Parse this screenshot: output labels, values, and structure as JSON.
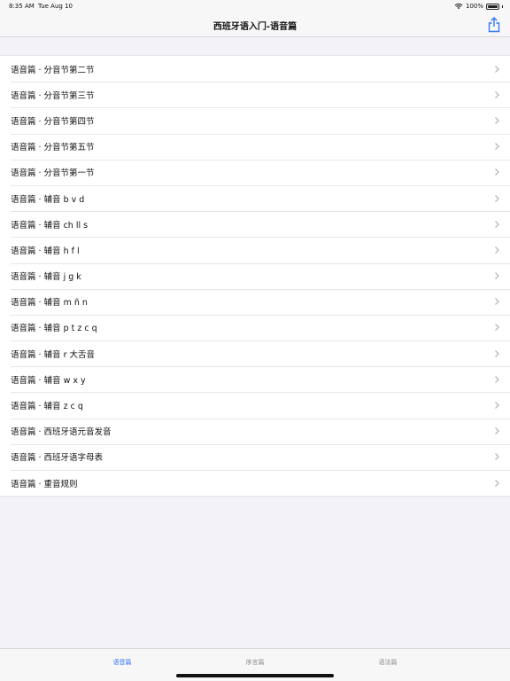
{
  "status_bar": {
    "time": "8:35 AM",
    "date": "Tue Aug 10",
    "battery": "100%",
    "icons": [
      "wifi-icon",
      "battery-icon"
    ]
  },
  "nav": {
    "title": "西班牙语入门-语音篇",
    "share_icon": "share-icon"
  },
  "list": {
    "items": [
      {
        "label": "语音篇 · 分音节第二节"
      },
      {
        "label": "语音篇 · 分音节第三节"
      },
      {
        "label": "语音篇 · 分音节第四节"
      },
      {
        "label": "语音篇 · 分音节第五节"
      },
      {
        "label": "语音篇 · 分音节第一节"
      },
      {
        "label": "语音篇 · 辅音 b v d"
      },
      {
        "label": "语音篇 · 辅音 ch ll s"
      },
      {
        "label": "语音篇 · 辅音 h f l"
      },
      {
        "label": "语音篇 · 辅音 j g k"
      },
      {
        "label": "语音篇 · 辅音 m ñ n"
      },
      {
        "label": "语音篇 · 辅音 p t z c q"
      },
      {
        "label": "语音篇 · 辅音 r 大舌音"
      },
      {
        "label": "语音篇 · 辅音 w x y"
      },
      {
        "label": "语音篇 · 辅音 z c q"
      },
      {
        "label": "语音篇 · 西班牙语元音发音"
      },
      {
        "label": "语音篇 · 西班牙语字母表"
      },
      {
        "label": "语音篇 · 重音规则"
      }
    ]
  },
  "tab_bar": {
    "tabs": [
      {
        "label": "语音篇",
        "active": true
      },
      {
        "label": "序言篇",
        "active": false
      },
      {
        "label": "语法篇",
        "active": false
      }
    ]
  },
  "colors": {
    "accent": "#3478f6",
    "background": "#f2f2f7",
    "inactive_tab": "#8e8e93"
  }
}
